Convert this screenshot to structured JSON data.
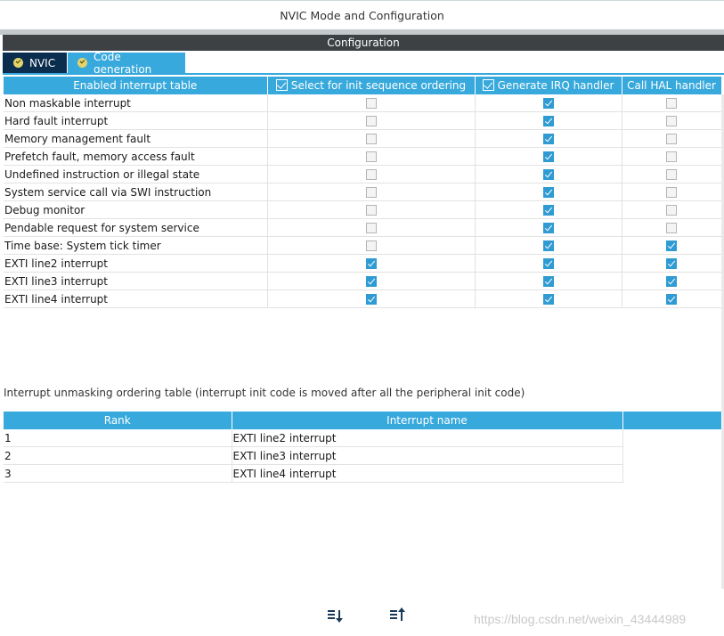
{
  "window": {
    "title": "NVIC Mode and Configuration"
  },
  "config_header": "Configuration",
  "tabs": [
    {
      "label": "NVIC",
      "active": true
    },
    {
      "label": "Code generation",
      "active": false
    }
  ],
  "irq_table": {
    "headers": {
      "name": "Enabled interrupt table",
      "init_seq": "Select for init sequence ordering",
      "gen_irq": "Generate IRQ handler",
      "call_hal": "Call HAL handler"
    },
    "rows": [
      {
        "name": "Non maskable interrupt",
        "init_seq": false,
        "gen_irq": true,
        "call_hal": false
      },
      {
        "name": "Hard fault interrupt",
        "init_seq": false,
        "gen_irq": true,
        "call_hal": false
      },
      {
        "name": "Memory management fault",
        "init_seq": false,
        "gen_irq": true,
        "call_hal": false
      },
      {
        "name": "Prefetch fault, memory access fault",
        "init_seq": false,
        "gen_irq": true,
        "call_hal": false
      },
      {
        "name": "Undefined instruction or illegal state",
        "init_seq": false,
        "gen_irq": true,
        "call_hal": false
      },
      {
        "name": "System service call via SWI instruction",
        "init_seq": false,
        "gen_irq": true,
        "call_hal": false
      },
      {
        "name": "Debug monitor",
        "init_seq": false,
        "gen_irq": true,
        "call_hal": false
      },
      {
        "name": "Pendable request for system service",
        "init_seq": false,
        "gen_irq": true,
        "call_hal": false
      },
      {
        "name": "Time base: System tick timer",
        "init_seq": false,
        "gen_irq": true,
        "call_hal": true
      },
      {
        "name": "EXTI line2 interrupt",
        "init_seq": true,
        "gen_irq": true,
        "call_hal": true
      },
      {
        "name": "EXTI line3 interrupt",
        "init_seq": true,
        "gen_irq": true,
        "call_hal": true
      },
      {
        "name": "EXTI line4 interrupt",
        "init_seq": true,
        "gen_irq": true,
        "call_hal": true
      }
    ]
  },
  "unmask_label": "Interrupt unmasking ordering table (interrupt init code is moved after all the peripheral init code)",
  "rank_table": {
    "headers": {
      "rank": "Rank",
      "name": "Interrupt name"
    },
    "rows": [
      {
        "rank": "1",
        "name": "EXTI line2 interrupt"
      },
      {
        "rank": "2",
        "name": "EXTI line3 interrupt"
      },
      {
        "rank": "3",
        "name": "EXTI line4 interrupt"
      }
    ]
  },
  "sort_buttons": [
    {
      "icon": "sort-descending-icon"
    },
    {
      "icon": "sort-ascending-icon"
    }
  ],
  "watermark": "https://blog.csdn.net/weixin_43444989",
  "colors": {
    "header_blue": "#38a9dc",
    "tab_active": "#0b2e4f",
    "config_bar": "#3d4144",
    "checked": "#2f9bd3"
  }
}
